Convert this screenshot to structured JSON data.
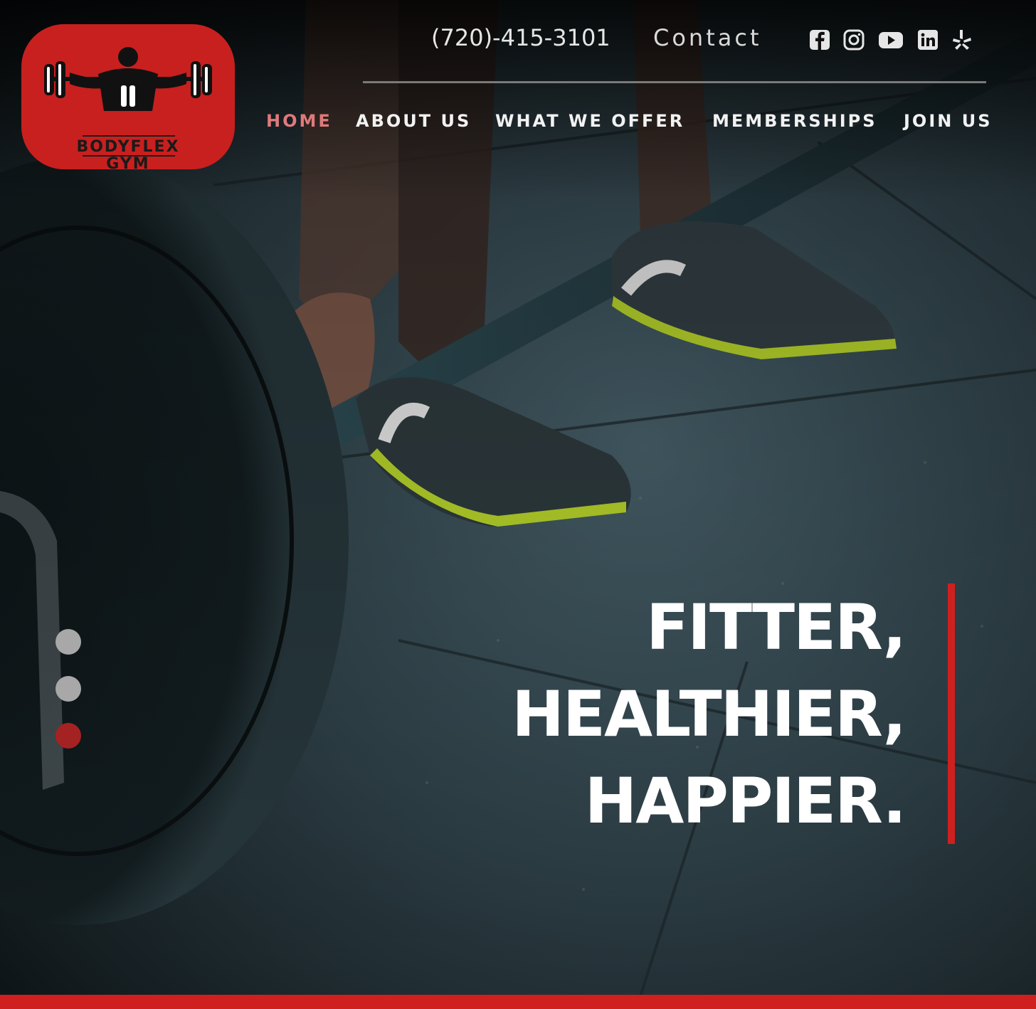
{
  "brand": {
    "logo_line1": "BODYFLEX",
    "logo_line2": "GYM",
    "accent_color": "#c8201f"
  },
  "topbar": {
    "phone": "(720)-415-3101",
    "contact_label": "Contact",
    "social_icons": [
      "facebook-icon",
      "instagram-icon",
      "youtube-icon",
      "linkedin-icon",
      "yelp-icon"
    ]
  },
  "nav": {
    "items": [
      {
        "label": "HOME",
        "active": true
      },
      {
        "label": "ABOUT US",
        "active": false
      },
      {
        "label": "WHAT WE OFFER",
        "active": false
      },
      {
        "label": "MEMBERSHIPS",
        "active": false
      },
      {
        "label": "JOIN US",
        "active": false
      }
    ]
  },
  "hero": {
    "headline_line1": "FITTER,",
    "headline_line2": "HEALTHIER,",
    "headline_line3": "HAPPIER.",
    "slides_total": 3,
    "active_slide": 3
  }
}
